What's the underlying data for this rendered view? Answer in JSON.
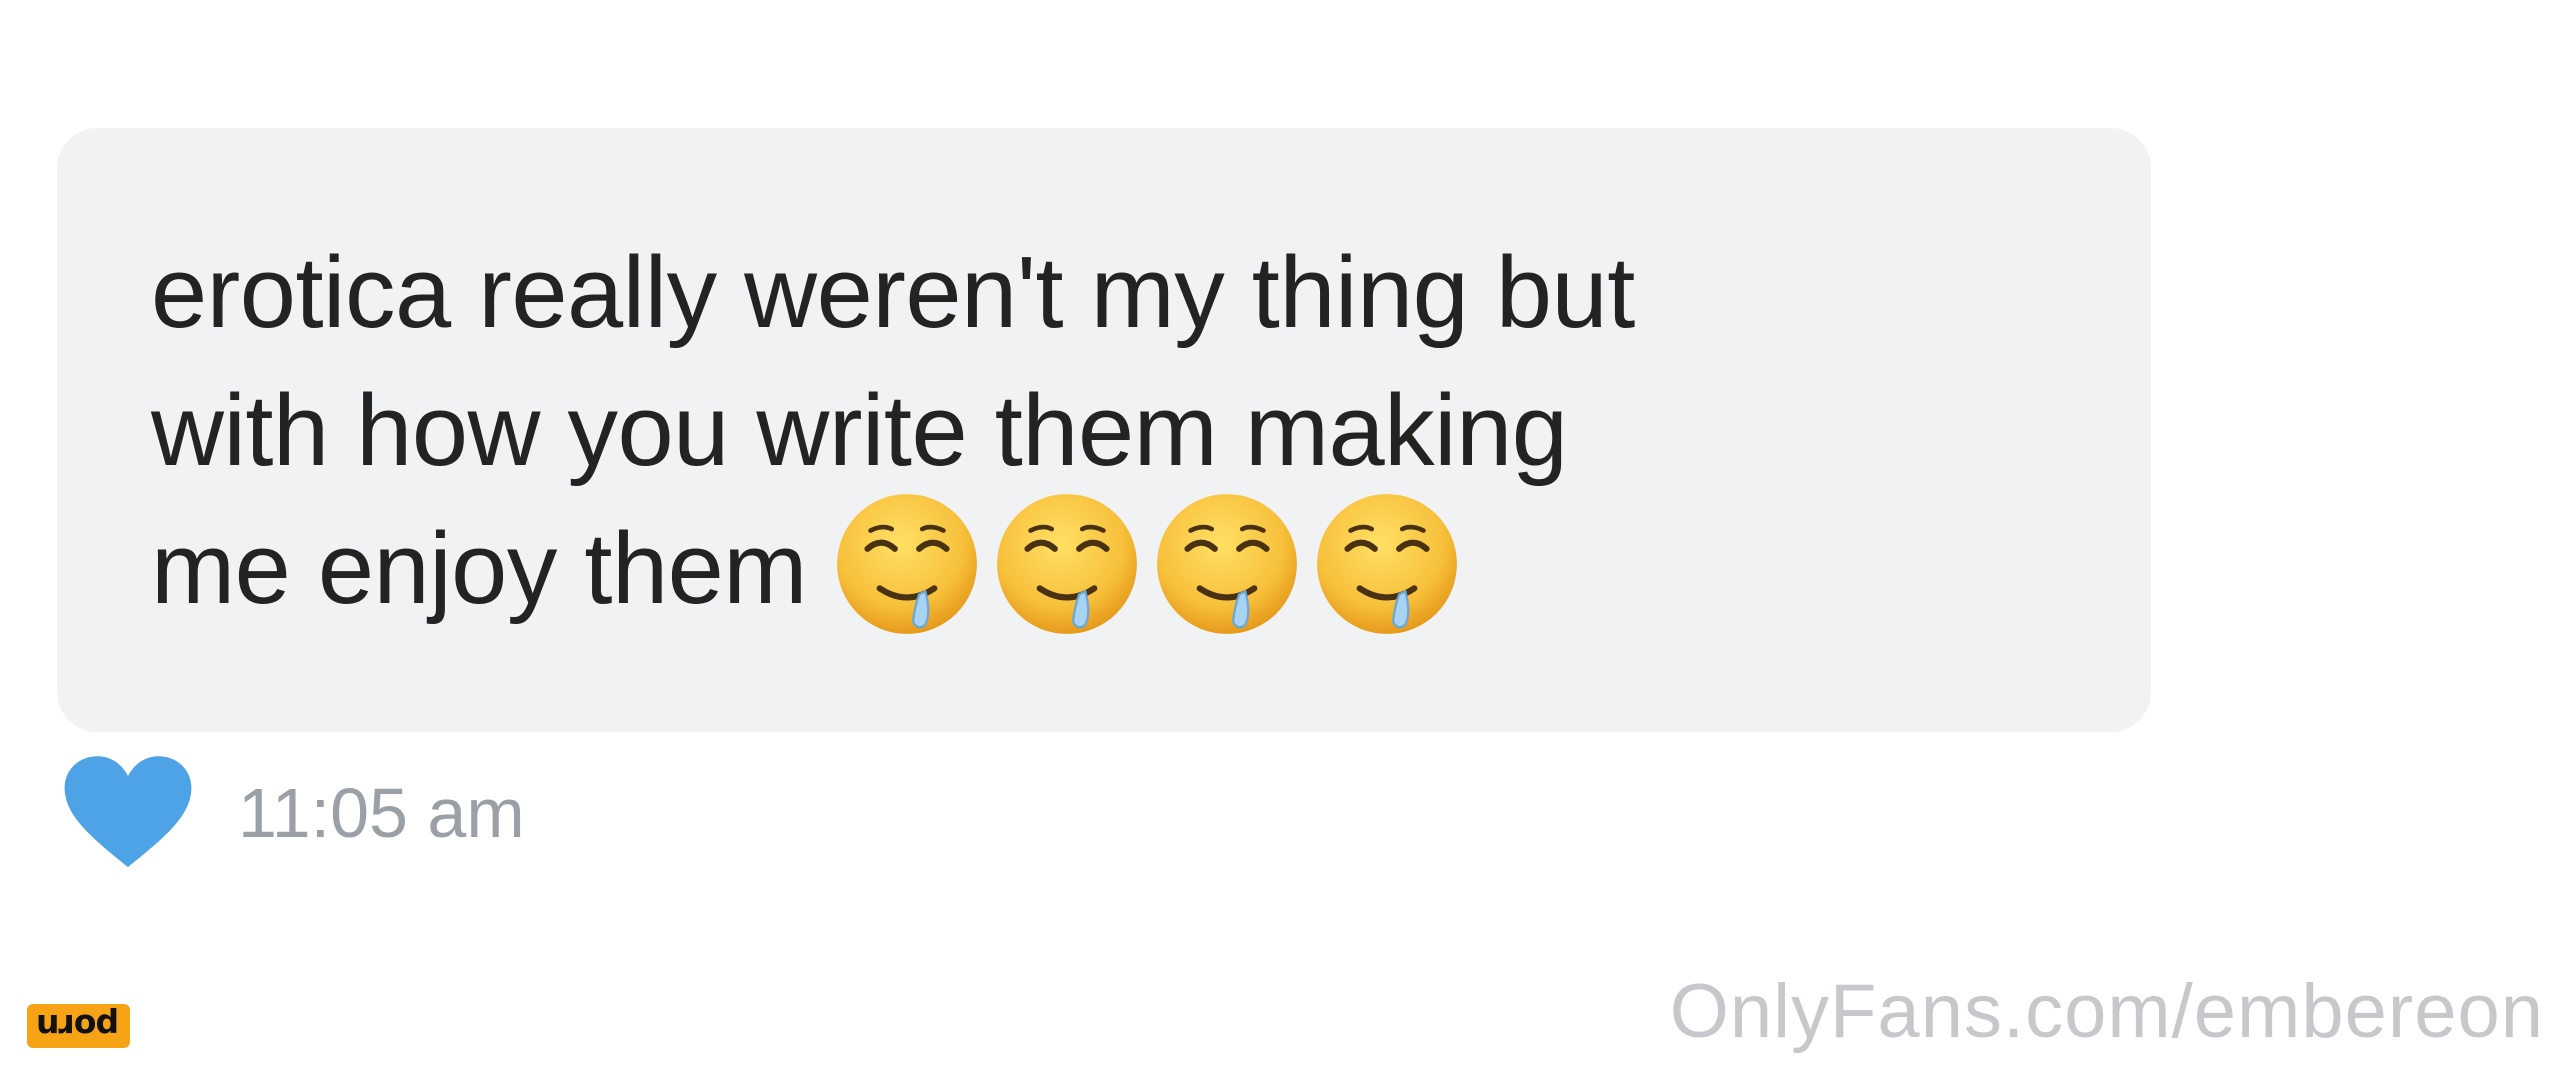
{
  "message": {
    "lines": [
      "erotica really weren't my thing but",
      "with how you write them making",
      "me enjoy them"
    ],
    "emojis": [
      "drooling-face-emoji",
      "drooling-face-emoji",
      "drooling-face-emoji",
      "drooling-face-emoji"
    ],
    "bubble_color": "#f1f2f4",
    "text_color": "#232323"
  },
  "meta": {
    "liked_icon": "heart-icon",
    "heart_color": "#4ea3e6",
    "time": "11:05 am"
  },
  "watermark": {
    "text": "OnlyFans.com/embereon"
  },
  "logo": {
    "text": "porn",
    "color": "#f6a316"
  }
}
